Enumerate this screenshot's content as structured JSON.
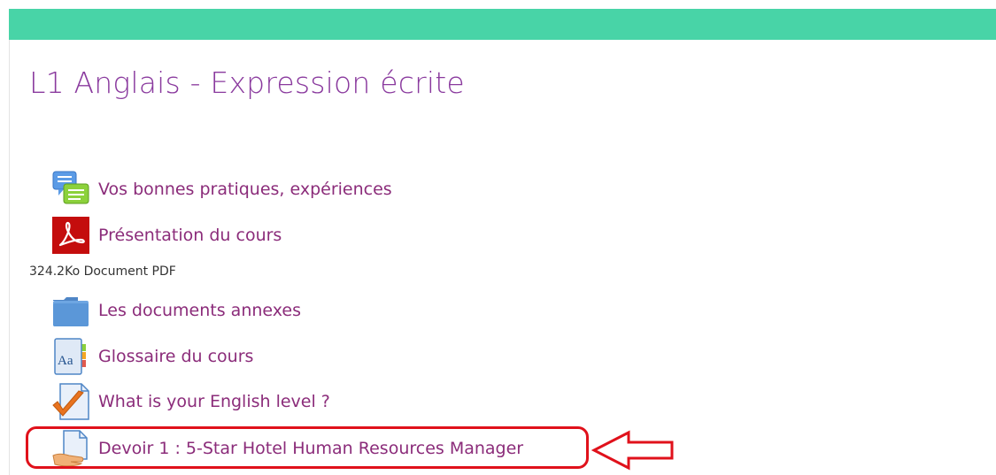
{
  "course": {
    "title": "L1 Anglais - Expression écrite"
  },
  "activities": [
    {
      "icon": "forum-icon",
      "label": "Vos bonnes pratiques, expériences"
    },
    {
      "icon": "pdf-icon",
      "label": "Présentation du cours",
      "meta": "324.2Ko Document PDF"
    },
    {
      "icon": "folder-icon",
      "label": "Les documents annexes"
    },
    {
      "icon": "glossary-icon",
      "label": "Glossaire du cours"
    },
    {
      "icon": "quiz-icon",
      "label": "What is your English level ?"
    },
    {
      "icon": "assignment-icon",
      "label": "Devoir 1 : 5-Star Hotel Human Resources Manager"
    }
  ],
  "colors": {
    "header": "#48d4a7",
    "title": "#8a3a9e",
    "link": "#8b2c7a",
    "highlight": "#e0111b"
  }
}
